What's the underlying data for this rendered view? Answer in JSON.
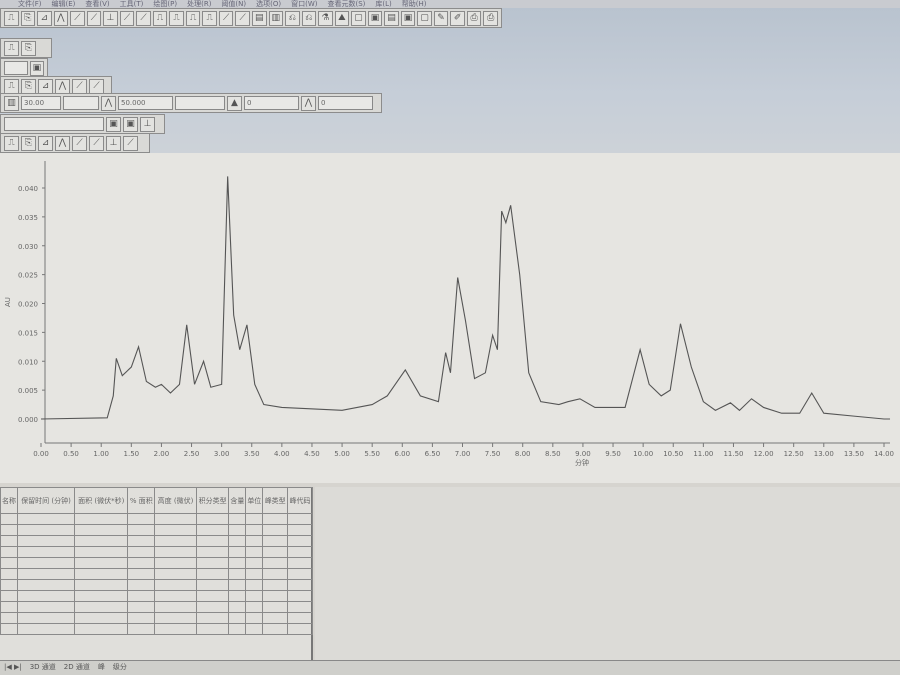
{
  "menu": [
    "文件(F)",
    "编辑(E)",
    "查看(V)",
    "工具(T)",
    "绘图(P)",
    "处理(R)",
    "阈值(N)",
    "选项(O)",
    "窗口(W)",
    "查看元数(S)",
    "库(L)",
    "帮助(H)"
  ],
  "toolbar": {
    "field1": "30.00",
    "field2": "50.000",
    "field3": "0",
    "field4": "0"
  },
  "chart_data": {
    "type": "line",
    "xlabel": "分钟",
    "ylabel": "AU",
    "xlim": [
      0,
      14.1
    ],
    "ylim": [
      0,
      0.04
    ],
    "xticks": [
      "0.00",
      "0.50",
      "1.00",
      "1.50",
      "2.00",
      "2.50",
      "3.00",
      "3.50",
      "4.00",
      "4.50",
      "5.00",
      "5.50",
      "6.00",
      "6.50",
      "7.00",
      "7.50",
      "8.00",
      "8.50",
      "9.00",
      "9.50",
      "10.00",
      "10.50",
      "11.00",
      "11.50",
      "12.00",
      "12.50",
      "13.00",
      "13.50",
      "14.00"
    ],
    "yticks": [
      "0.000",
      "0.005",
      "0.010",
      "0.015",
      "0.020",
      "0.025",
      "0.030",
      "0.035",
      "0.040"
    ],
    "grid": false,
    "series": [
      {
        "x": [
          0,
          1.1,
          1.2,
          1.25,
          1.35,
          1.5,
          1.62,
          1.75,
          1.9,
          2.0,
          2.15,
          2.3,
          2.42,
          2.55,
          2.7,
          2.82,
          3.0,
          3.1,
          3.2,
          3.3,
          3.42,
          3.55,
          3.7,
          4.0,
          5.0,
          5.5,
          5.75,
          6.05,
          6.3,
          6.6,
          6.72,
          6.8,
          6.92,
          7.05,
          7.2,
          7.38,
          7.5,
          7.58,
          7.65,
          7.72,
          7.8,
          7.95,
          8.1,
          8.3,
          8.6,
          8.75,
          8.95,
          9.2,
          9.7,
          9.95,
          10.1,
          10.3,
          10.45,
          10.62,
          10.8,
          11.0,
          11.2,
          11.45,
          11.6,
          11.8,
          12.0,
          12.3,
          12.6,
          12.8,
          13.0,
          13.5,
          14.0,
          14.1
        ],
        "y": [
          0,
          0.0002,
          0.004,
          0.0105,
          0.0075,
          0.009,
          0.0125,
          0.0065,
          0.0055,
          0.006,
          0.0045,
          0.006,
          0.0163,
          0.006,
          0.01,
          0.0055,
          0.006,
          0.042,
          0.018,
          0.012,
          0.0163,
          0.006,
          0.0025,
          0.002,
          0.0015,
          0.0025,
          0.004,
          0.0085,
          0.004,
          0.003,
          0.0115,
          0.008,
          0.0245,
          0.017,
          0.007,
          0.008,
          0.0145,
          0.012,
          0.036,
          0.034,
          0.037,
          0.025,
          0.008,
          0.003,
          0.0025,
          0.003,
          0.0035,
          0.002,
          0.002,
          0.012,
          0.006,
          0.004,
          0.005,
          0.0165,
          0.009,
          0.003,
          0.0015,
          0.0028,
          0.0015,
          0.0035,
          0.002,
          0.001,
          0.001,
          0.0045,
          0.001,
          0.0005,
          0,
          0
        ]
      }
    ]
  },
  "table": {
    "headers": [
      "名称",
      "保留时间 (分钟)",
      "面积 (微伏*秒)",
      "% 面积",
      "高度 (微伏)",
      "积分类型",
      "含量",
      "单位",
      "峰类型",
      "峰代码"
    ]
  },
  "tabs": [
    "3D 通道",
    "2D 通道",
    "峰",
    "级分"
  ]
}
